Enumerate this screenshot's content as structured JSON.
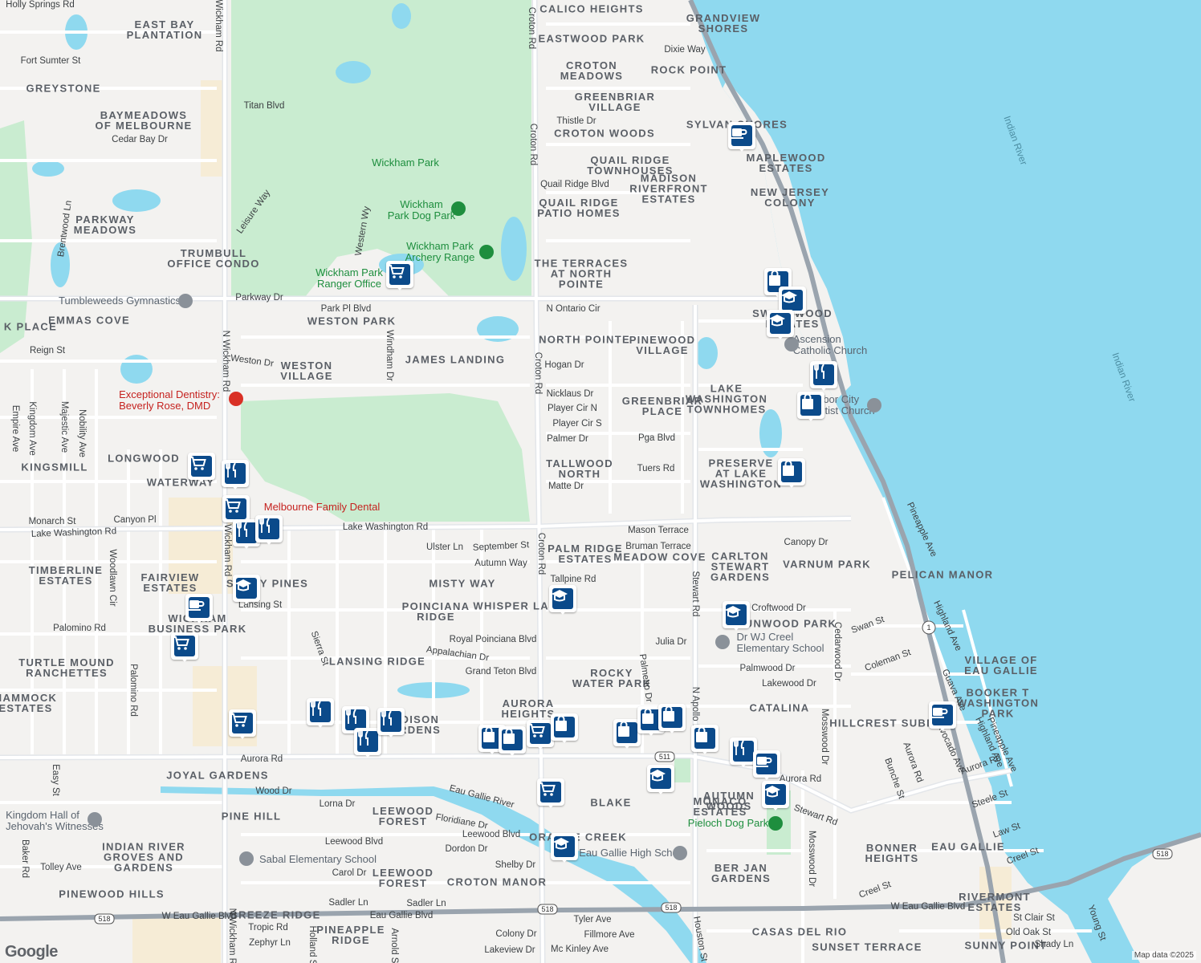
{
  "map": {
    "attribution": "Map data ©2025",
    "logo": "Google",
    "colors": {
      "land": "#f3f2f0",
      "water": "#8fd9ef",
      "park": "#c9ecd0",
      "road": "#ffffff",
      "highway": "#9aa4ae"
    }
  },
  "neighborhoods": [
    "EAST BAY\nPLANTATION",
    "GREYSTONE",
    "BAYMEADOWS\nOF MELBOURNE",
    "PARKWAY\nMEADOWS",
    "TRUMBULL\nOFFICE CONDO",
    "EMMAS COVE",
    "K PLACE",
    "WESTON PARK",
    "WESTON\nVILLAGE",
    "JAMES LANDING",
    "LONGWOOD",
    "KINGSMILL",
    "WATERWAY",
    "TIMBERLINE\nESTATES",
    "FAIRVIEW\nESTATES",
    "SANDY PINES",
    "MISTY WAY",
    "POINCIANA\nRIDGE",
    "WHISPER LAKES",
    "WICKHAM\nBUSINESS PARK",
    "TURTLE MOUND\nRANCHETTES",
    "HAMMOCK\nESTATES",
    "LANSING RIDGE",
    "MADISON\nGARDENS",
    "AURORA\nHEIGHTS",
    "JOYAL GARDENS",
    "PINE HILL",
    "LEEWOOD\nFOREST",
    "INDIAN RIVER\nGROVES AND\nGARDENS",
    "PINEWOOD HILLS",
    "LEEWOOD\nFOREST",
    "CROTON MANOR",
    "BREEZE RIDGE",
    "PINEAPPLE\nRIDGE",
    "ORANGE CREEK",
    "BLAKE",
    "CALICO HEIGHTS",
    "EASTWOOD PARK",
    "CROTON\nMEADOWS",
    "CROTON WOODS",
    "QUAIL RIDGE\nTOWNHOUSES",
    "QUAIL RIDGE\nPATIO HOMES",
    "THE TERRACES\nAT NORTH\nPOINTE",
    "NORTH POINTE",
    "PINEWOOD\nVILLAGE",
    "GREENBRIAR\nVILLAGE",
    "GREENBRIAR\nPLACE",
    "TALLWOOD\nNORTH",
    "PALM RIDGE\nESTATES",
    "MEADOW COVE",
    "CARLTON\nSTEWART\nGARDENS",
    "ROCKY\nWATER PARK",
    "GRANDVIEW\nSHORES",
    "ROCK POINT",
    "SYLVAN SHORES",
    "MAPLEWOOD\nESTATES",
    "MADISON\nRIVERFRONT\nESTATES",
    "NEW JERSEY\nCOLONY",
    "SWEETWOOD\nESTATES",
    "MONACO\nESTATES",
    "LAKE\nWASHINGTON\nTOWNHOMES",
    "PRESERVE\nAT LAKE\nWASHINGTON",
    "VARNUM PARK",
    "PELICAN MANOR",
    "SUNWOOD PARK",
    "CATALINA",
    "AUTUMN\nWOODS",
    "BER JAN\nGARDENS",
    "CASAS DEL RIO",
    "VILLAGE OF\nEAU GALLIE",
    "BOOKER T\nWASHINGTON\nPARK",
    "HILLCREST SUBD",
    "BONNER\nHEIGHTS",
    "EAU GALLIE",
    "RIVERMONT\nESTATES",
    "SUNSET TERRACE",
    "SUNNY POINT"
  ],
  "streets": [
    "Holly Springs Rd",
    "Fort Sumter St",
    "Titan Blvd",
    "Cedar Bay Dr",
    "Leisure Way",
    "Brentwood Ln",
    "Western Wy",
    "Parkway Dr",
    "Park Pl Blvd",
    "Reign St",
    "Weston Dr",
    "Windham Dr",
    "Empire Ave",
    "Kingdom Ave",
    "Majestic Ave",
    "Nobility Ave",
    "Monarch St",
    "Canyon Pl",
    "Lake Washington Rd",
    "Lake Washington Rd",
    "Woodlawn Cir",
    "Ulster Ln",
    "September St",
    "Autumn Way",
    "Lansing St",
    "Palomino Rd",
    "Palomino Rd",
    "Sierra St",
    "Appalachian Dr",
    "Royal Poinciana Blvd",
    "Grand Teton Blvd",
    "Aurora Rd",
    "Easy St",
    "Lorna Dr",
    "Floridiane Dr",
    "Leewood Blvd",
    "Leewood Blvd",
    "Dordon Dr",
    "Carol Dr",
    "Shelby Dr",
    "Baker Rd",
    "Tolley Ave",
    "Sadler Ln",
    "Sadler Ln",
    "Eau Gallie Blvd",
    "W Eau Gallie Blvd",
    "W Eau Gallie Blvd",
    "Tropic Rd",
    "Zephyr Ln",
    "Holland St",
    "Arnold St",
    "N Wickham Rd",
    "N Wickham Rd",
    "N Wickham Rd",
    "Wickham Rd",
    "Croton Rd",
    "Croton Rd",
    "Croton Rd",
    "Croton Rd",
    "Tyler Ave",
    "Fillmore Ave",
    "Colony Dr",
    "Mc Kinley Ave",
    "Lakeview Dr",
    "Thistle Dr",
    "Quail Ridge Blvd",
    "N Ontario Cir",
    "Hogan Dr",
    "Nicklaus Dr",
    "Player Cir N",
    "Player Cir S",
    "Palmer Dr",
    "Pga Blvd",
    "Matte Dr",
    "Tuers Rd",
    "Mason Terrace",
    "Bruman Terrace",
    "Tallpine Rd",
    "Stewart Rd",
    "Julia Dr",
    "Palmetto Dr",
    "Palmwood Dr",
    "Lakewood Dr",
    "Croftwood Dr",
    "Canopy Dr",
    "Cedarwood Dr",
    "Mosswood Dr",
    "Mosswood Dr",
    "Swan St",
    "Coleman St",
    "Dixie Way",
    "Pineapple Ave",
    "Pineapple Ave",
    "Highland Ave",
    "Highland Ave",
    "Guava Ave",
    "Avocado Ave",
    "Aurora Rd",
    "Aurora Rd",
    "Bunche St",
    "Steele St",
    "Law St",
    "Creel St",
    "Creel St",
    "St Clair St",
    "Old Oak St",
    "Shady Ln",
    "Young St",
    "Houston St",
    "N Apollo Blvd",
    "Stewart Rd",
    "Aurora Rd",
    "Wood Dr",
    "Eau Gallie River",
    "Eau Gallie River"
  ],
  "pois": [
    {
      "name": "Wickham Park",
      "kind": "park"
    },
    {
      "name": "Wickham\nPark Dog Park",
      "kind": "park"
    },
    {
      "name": "Wickham Park\nArchery Range",
      "kind": "park"
    },
    {
      "name": "Wickham Park\nRanger Office",
      "kind": "park"
    },
    {
      "name": "Tumbleweeds Gymnastics",
      "kind": "place"
    },
    {
      "name": "Exceptional Dentistry:\nBeverly Rose, DMD",
      "kind": "medical"
    },
    {
      "name": "Melbourne Family Dental",
      "kind": "medical"
    },
    {
      "name": "Ascension\nCatholic Church",
      "kind": "place"
    },
    {
      "name": "Harbor City\nBaptist Church",
      "kind": "place"
    },
    {
      "name": "Dr WJ Creel\nElementary School",
      "kind": "place"
    },
    {
      "name": "Kingdom Hall of\nJehovah's Witnesses",
      "kind": "place"
    },
    {
      "name": "Sabal Elementary School",
      "kind": "place"
    },
    {
      "name": "Eau Gallie High School",
      "kind": "place"
    },
    {
      "name": "Pieloch Dog Park",
      "kind": "park"
    }
  ],
  "water_labels": [
    "Indian River",
    "Indian River"
  ],
  "route_shields": [
    "1",
    "511",
    "518",
    "518",
    "518",
    "518"
  ],
  "markers": [
    {
      "icon": "cafe-icon"
    },
    {
      "icon": "shopping-cart-icon"
    },
    {
      "icon": "shopping-bag-icon"
    },
    {
      "icon": "school-icon"
    },
    {
      "icon": "school-icon"
    },
    {
      "icon": "restaurant-icon"
    },
    {
      "icon": "shopping-bag-icon"
    },
    {
      "icon": "shopping-bag-icon"
    },
    {
      "icon": "shopping-cart-icon"
    },
    {
      "icon": "restaurant-icon"
    },
    {
      "icon": "shopping-cart-icon"
    },
    {
      "icon": "restaurant-icon"
    },
    {
      "icon": "restaurant-icon"
    },
    {
      "icon": "school-icon"
    },
    {
      "icon": "cafe-icon"
    },
    {
      "icon": "shopping-cart-icon"
    },
    {
      "icon": "school-icon"
    },
    {
      "icon": "school-icon"
    },
    {
      "icon": "shopping-cart-icon"
    },
    {
      "icon": "restaurant-icon"
    },
    {
      "icon": "restaurant-icon"
    },
    {
      "icon": "restaurant-icon"
    },
    {
      "icon": "restaurant-icon"
    },
    {
      "icon": "shopping-bag-icon"
    },
    {
      "icon": "shopping-bag-icon"
    },
    {
      "icon": "shopping-cart-icon"
    },
    {
      "icon": "shopping-bag-icon"
    },
    {
      "icon": "shopping-bag-icon"
    },
    {
      "icon": "shopping-bag-icon"
    },
    {
      "icon": "shopping-bag-icon"
    },
    {
      "icon": "shopping-bag-icon"
    },
    {
      "icon": "restaurant-icon"
    },
    {
      "icon": "cafe-icon"
    },
    {
      "icon": "school-icon"
    },
    {
      "icon": "school-icon"
    },
    {
      "icon": "shopping-cart-icon"
    },
    {
      "icon": "school-icon"
    },
    {
      "icon": "cafe-icon"
    }
  ]
}
